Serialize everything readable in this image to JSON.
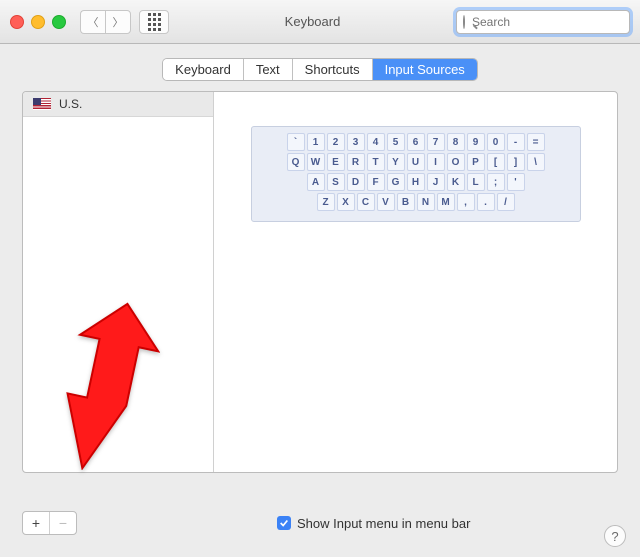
{
  "window": {
    "title": "Keyboard",
    "search_placeholder": "Search"
  },
  "tabs": [
    "Keyboard",
    "Text",
    "Shortcuts",
    "Input Sources"
  ],
  "sources": [
    {
      "name": "U.S.",
      "flag": "us"
    }
  ],
  "keyboard_rows": [
    [
      "`",
      "1",
      "2",
      "3",
      "4",
      "5",
      "6",
      "7",
      "8",
      "9",
      "0",
      "-",
      "="
    ],
    [
      "Q",
      "W",
      "E",
      "R",
      "T",
      "Y",
      "U",
      "I",
      "O",
      "P",
      "[",
      "]",
      "\\"
    ],
    [
      "A",
      "S",
      "D",
      "F",
      "G",
      "H",
      "J",
      "K",
      "L",
      ";",
      "'"
    ],
    [
      "Z",
      "X",
      "C",
      "V",
      "B",
      "N",
      "M",
      ",",
      ".",
      "/"
    ]
  ],
  "footer": {
    "add": "+",
    "remove": "−",
    "checkbox_checked": true,
    "checkbox_label": "Show Input menu in menu bar",
    "help": "?"
  }
}
